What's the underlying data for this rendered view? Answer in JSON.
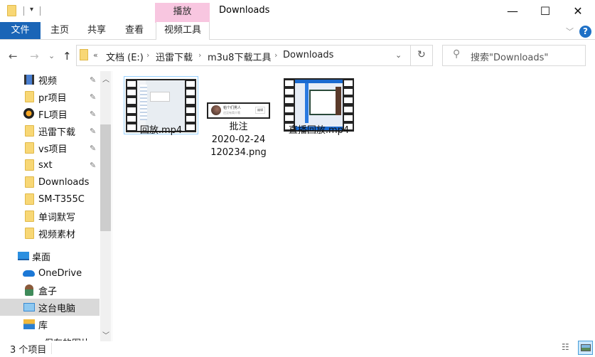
{
  "titlebar": {
    "title": "Downloads",
    "context_tab_group": "播放",
    "context_color": "#f8c6e0",
    "minimize": "—",
    "maximize": "☐",
    "close": "✕"
  },
  "ribbon": {
    "file_tab": "文件",
    "tabs": [
      "主页",
      "共享",
      "查看"
    ],
    "context_tab": "视频工具",
    "file_color": "#1a65b7"
  },
  "nav": {
    "back": "←",
    "forward": "→",
    "recent": "⌄",
    "up": "↑",
    "overflow": "«",
    "breadcrumbs": [
      "文档 (E:)",
      "迅雷下载",
      "m3u8下载工具",
      "Downloads"
    ],
    "dropdown": "⌄",
    "refresh": "↻"
  },
  "search": {
    "placeholder": "搜索\"Downloads\""
  },
  "sidebar": {
    "quick_access": [
      {
        "label": "视频",
        "icon": "video-library-icon",
        "pinned": true
      },
      {
        "label": "pr项目",
        "icon": "folder-icon",
        "pinned": true
      },
      {
        "label": "FL项目",
        "icon": "fl-studio-icon",
        "pinned": true
      },
      {
        "label": "迅雷下载",
        "icon": "folder-icon",
        "pinned": true
      },
      {
        "label": "vs项目",
        "icon": "folder-icon",
        "pinned": true
      },
      {
        "label": "sxt",
        "icon": "folder-icon",
        "pinned": true
      },
      {
        "label": "Downloads",
        "icon": "folder-icon",
        "pinned": false
      },
      {
        "label": "SM-T355C",
        "icon": "folder-icon",
        "pinned": false
      },
      {
        "label": "单词默写",
        "icon": "folder-icon",
        "pinned": false
      },
      {
        "label": "视频素材",
        "icon": "folder-icon",
        "pinned": false
      }
    ],
    "locations": [
      {
        "label": "桌面",
        "icon": "desktop-icon"
      },
      {
        "label": "OneDrive",
        "icon": "onedrive-icon"
      },
      {
        "label": "盒子",
        "icon": "user-icon"
      },
      {
        "label": "这台电脑",
        "icon": "this-pc-icon",
        "selected": true
      },
      {
        "label": "库",
        "icon": "library-icon"
      },
      {
        "label": "保存的图片",
        "icon": "none"
      }
    ],
    "pin_glyph": "📌"
  },
  "files": [
    {
      "name": "回放.mp4",
      "type": "video",
      "selected": true
    },
    {
      "name": "批注\n2020-02-24\n120234.png",
      "lines": [
        "批注",
        "2020-02-24",
        "120234.png"
      ],
      "type": "image",
      "preview": {
        "title": "帕个们男人",
        "subtitle": "还没有简介哦",
        "button": "编辑"
      }
    },
    {
      "name": "直播回放.mp4",
      "type": "video",
      "selected": false
    }
  ],
  "status": {
    "count": "3 个项目"
  }
}
